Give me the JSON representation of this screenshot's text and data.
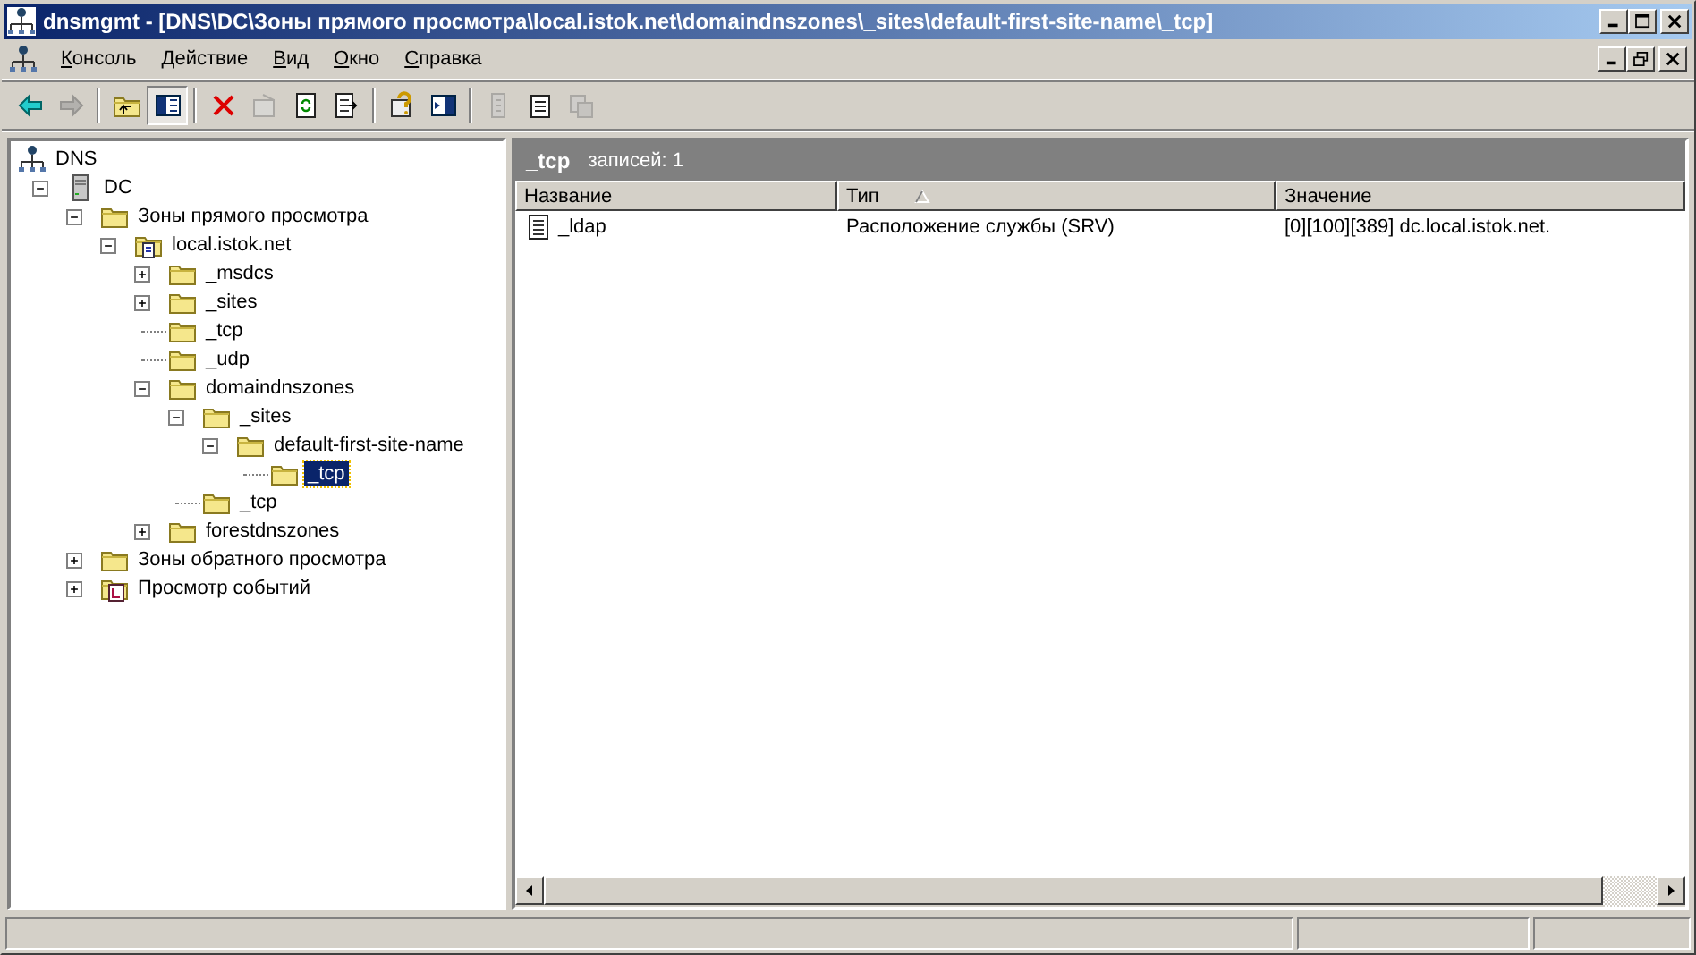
{
  "window": {
    "title": "dnsmgmt - [DNS\\DC\\Зоны прямого просмотра\\local.istok.net\\domaindnszones\\_sites\\default-first-site-name\\_tcp]"
  },
  "menu": [
    "Консоль",
    "Действие",
    "Вид",
    "Окно",
    "Справка"
  ],
  "toolbar_groups": [
    [
      {
        "kind": "back",
        "disabled": false,
        "on": false
      },
      {
        "kind": "forward",
        "disabled": true,
        "on": false
      }
    ],
    [
      {
        "kind": "up",
        "disabled": false,
        "on": false
      },
      {
        "kind": "tree",
        "disabled": false,
        "on": true
      }
    ],
    [
      {
        "kind": "delete",
        "disabled": false,
        "on": false
      },
      {
        "kind": "properties",
        "disabled": true,
        "on": false
      },
      {
        "kind": "refresh",
        "disabled": false,
        "on": false
      },
      {
        "kind": "export",
        "disabled": false,
        "on": false
      }
    ],
    [
      {
        "kind": "help",
        "disabled": false,
        "on": false
      },
      {
        "kind": "pane",
        "disabled": false,
        "on": false
      }
    ],
    [
      {
        "kind": "record",
        "disabled": true,
        "on": false
      },
      {
        "kind": "notes",
        "disabled": false,
        "on": false
      },
      {
        "kind": "copies",
        "disabled": true,
        "on": false
      }
    ]
  ],
  "tree": {
    "label": "DNS",
    "kind": "dns",
    "children": [
      {
        "label": "DC",
        "kind": "server",
        "expandable": true,
        "expanded": true,
        "selected": false,
        "children": [
          {
            "label": "Зоны прямого просмотра",
            "kind": "folder",
            "expandable": true,
            "expanded": true,
            "selected": false,
            "children": [
              {
                "label": "local.istok.net",
                "kind": "zone",
                "expandable": true,
                "expanded": true,
                "selected": false,
                "children": [
                  {
                    "label": "_msdcs",
                    "kind": "folder",
                    "expandable": true,
                    "expanded": false,
                    "selected": false
                  },
                  {
                    "label": "_sites",
                    "kind": "folder",
                    "expandable": true,
                    "expanded": false,
                    "selected": false
                  },
                  {
                    "label": "_tcp",
                    "kind": "folder",
                    "expandable": false,
                    "selected": false
                  },
                  {
                    "label": "_udp",
                    "kind": "folder",
                    "expandable": false,
                    "selected": false
                  },
                  {
                    "label": "domaindnszones",
                    "kind": "folder",
                    "expandable": true,
                    "expanded": true,
                    "selected": false,
                    "children": [
                      {
                        "label": "_sites",
                        "kind": "folder",
                        "expandable": true,
                        "expanded": true,
                        "selected": false,
                        "children": [
                          {
                            "label": "default-first-site-name",
                            "kind": "folder",
                            "expandable": true,
                            "expanded": true,
                            "selected": false,
                            "children": [
                              {
                                "label": "_tcp",
                                "kind": "folder",
                                "expandable": false,
                                "selected": true
                              }
                            ]
                          }
                        ]
                      },
                      {
                        "label": "_tcp",
                        "kind": "folder",
                        "expandable": false,
                        "selected": false
                      }
                    ]
                  },
                  {
                    "label": "forestdnszones",
                    "kind": "folder",
                    "expandable": true,
                    "expanded": false,
                    "selected": false
                  }
                ]
              }
            ]
          },
          {
            "label": "Зоны обратного просмотра",
            "kind": "folder",
            "expandable": true,
            "expanded": false,
            "selected": false
          },
          {
            "label": "Просмотр событий",
            "kind": "events",
            "expandable": true,
            "expanded": false,
            "selected": false
          }
        ]
      }
    ]
  },
  "details": {
    "title": "_tcp",
    "count": "записей: 1",
    "columns": [
      {
        "label": "Название",
        "sorted": false
      },
      {
        "label": "Тип",
        "sorted": true
      },
      {
        "label": "Значение",
        "sorted": false
      }
    ],
    "rows": [
      {
        "kind": "record",
        "selected": false,
        "cells": [
          "_ldap",
          "Расположение службы (SRV)",
          "[0][100][389] dc.local.istok.net."
        ]
      }
    ]
  }
}
